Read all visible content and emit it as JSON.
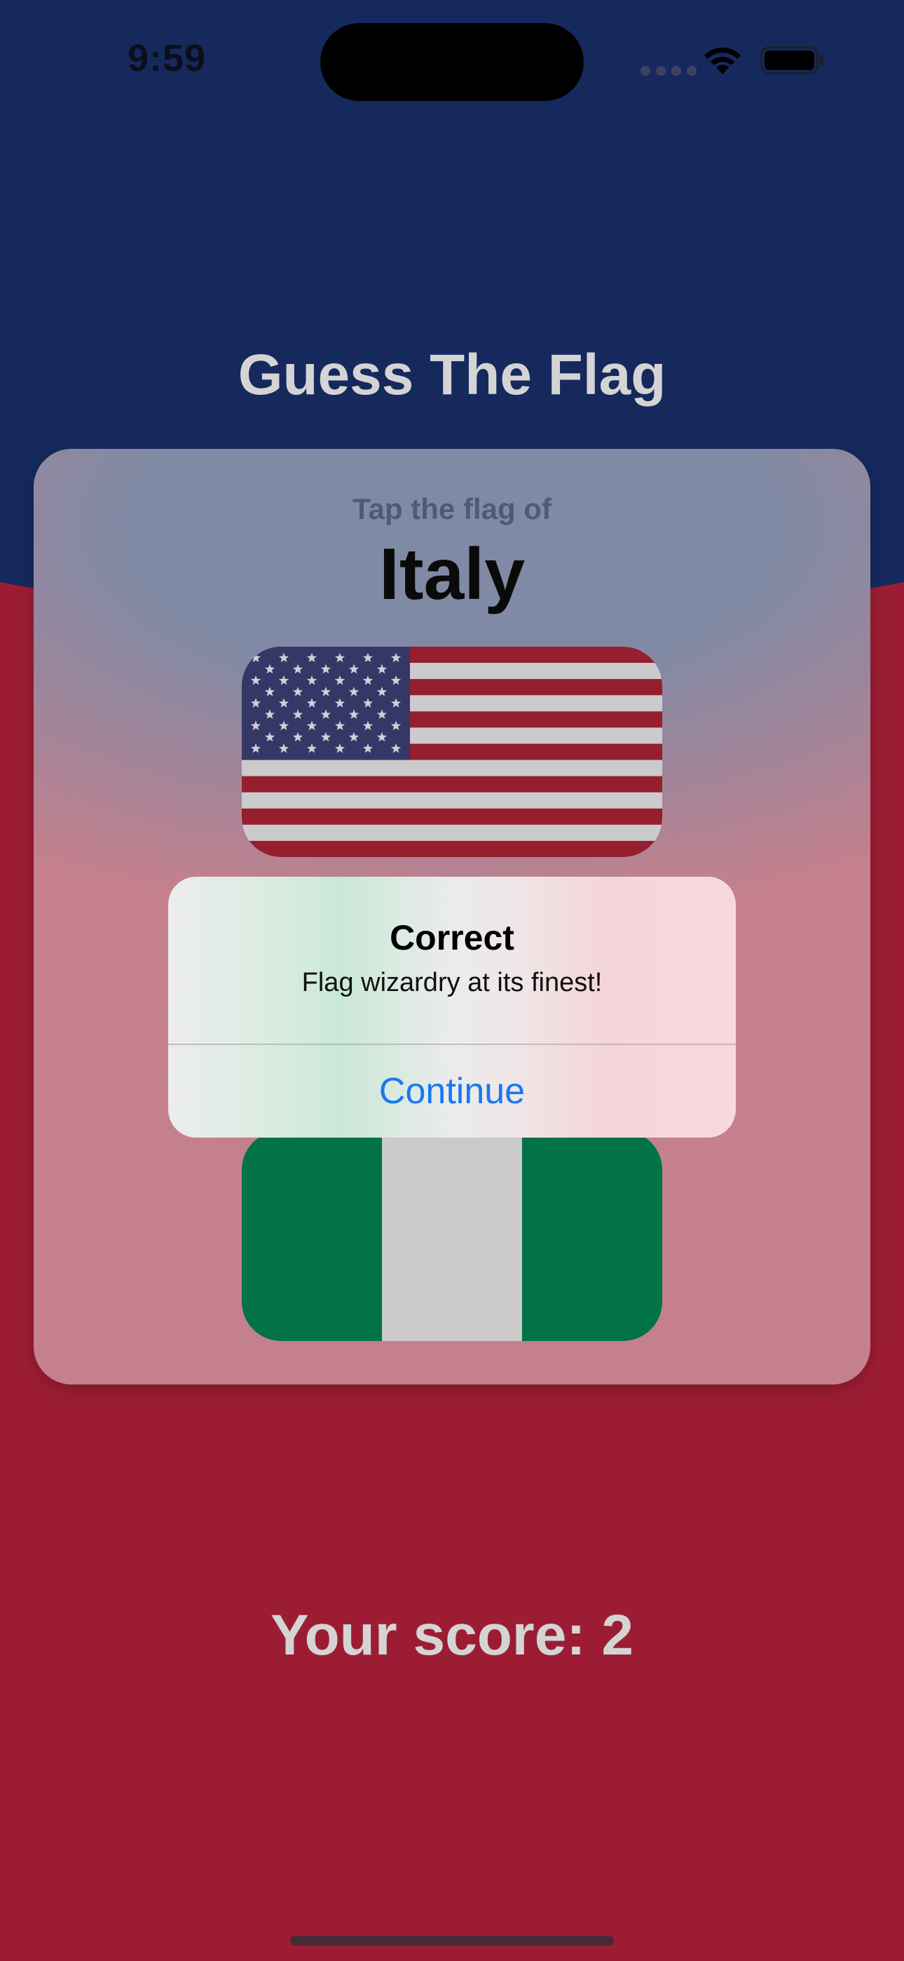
{
  "status_bar": {
    "time": "9:59",
    "icons": [
      "signal-icon",
      "wifi-icon",
      "battery-icon"
    ]
  },
  "header": {
    "title": "Guess The Flag"
  },
  "question": {
    "prompt": "Tap the flag of",
    "country": "Italy"
  },
  "flags": [
    {
      "country": "United States",
      "icon": "us-flag-icon"
    },
    {
      "country": "Nigeria",
      "icon": "nigeria-flag-icon"
    }
  ],
  "alert": {
    "title": "Correct",
    "message": "Flag wizardry at its finest!",
    "button_label": "Continue"
  },
  "footer": {
    "score_text": "Your score: 2"
  },
  "colors": {
    "background_top": "#15295d",
    "background_bottom": "#9c1d33",
    "alert_button": "#1878f2",
    "us_red": "#961f2f",
    "us_white": "#cbcbcb",
    "us_blue": "#353766",
    "nigeria_green": "#017346",
    "nigeria_white": "#cacaca"
  }
}
